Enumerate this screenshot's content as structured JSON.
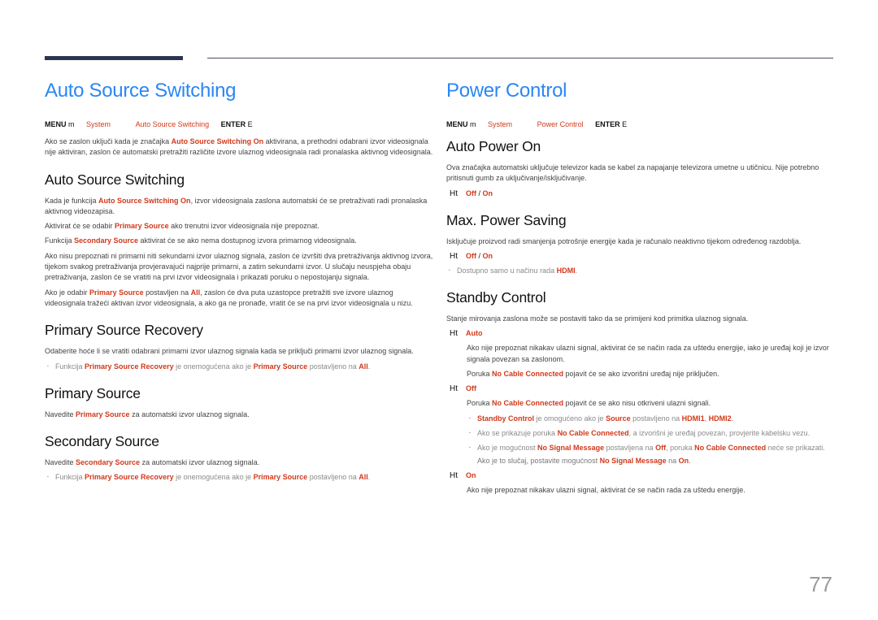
{
  "colors": {
    "title_blue": "#2a87f5",
    "accent_red": "#d1391b",
    "header_bar": "#2d3450"
  },
  "left": {
    "title": "Auto Source Switching",
    "menu": {
      "menu": "MENU",
      "menu_icon": "m",
      "system": "System",
      "item": "Auto Source Switching",
      "enter": "ENTER",
      "enter_icon": "E"
    },
    "intro": {
      "t1": "Ako se zaslon uključi kada je značajka ",
      "h1": "Auto Source Switching On",
      "t2": " aktivirana, a prethodni odabrani izvor videosignala nije aktiviran, zaslon će automatski pretražiti različite izvore ulaznog videosignala radi pronalaska aktivnog videosignala."
    },
    "s1": {
      "heading": "Auto Source Switching",
      "p1": {
        "t1": "Kada je funkcija ",
        "h1": "Auto Source Switching On",
        "t2": ", izvor videosignala zaslona automatski će se pretraživati radi pronalaska aktivnog videozapisa."
      },
      "p2": {
        "t1": "Aktivirat će se odabir ",
        "h1": "Primary Source",
        "t2": " ako trenutni izvor videosignala nije prepoznat."
      },
      "p3": {
        "t1": "Funkcija ",
        "h1": "Secondary Source",
        "t2": " aktivirat će se ako nema dostupnog izvora primarnog videosignala."
      },
      "p4": "Ako nisu prepoznati ni primarni niti sekundarni izvor ulaznog signala, zaslon će izvršiti dva pretraživanja aktivnog izvora, tijekom svakog pretraživanja provjeravajući najprije primarni, a zatim sekundarni izvor. U slučaju neuspjeha obaju pretraživanja, zaslon će se vratiti na prvi izvor videosignala i prikazati poruku o nepostojanju signala.",
      "p5": {
        "t1": "Ako je odabir ",
        "h1": "Primary Source",
        "t2": " postavljen na ",
        "h2": "All",
        "t3": ", zaslon će dva puta uzastopce pretražiti sve izvore ulaznog videosignala tražeći aktivan izvor videosignala, a ako ga ne pronađe, vratit će se na prvi izvor videosignala u nizu."
      }
    },
    "s2": {
      "heading": "Primary Source Recovery",
      "p1": "Odaberite hoće li se vratiti odabrani primarni izvor ulaznog signala kada se priključi primarni izvor ulaznog signala.",
      "note": {
        "t1": "Funkcija ",
        "h1": "Primary Source Recovery",
        "t2": " je onemogućena ako je ",
        "h2": "Primary Source",
        "t3": " postavljeno na ",
        "h3": "All",
        "t4": "."
      }
    },
    "s3": {
      "heading": "Primary Source",
      "p1": {
        "t1": "Navedite ",
        "h1": "Primary Source",
        "t2": " za automatski izvor ulaznog signala."
      }
    },
    "s4": {
      "heading": "Secondary Source",
      "p1": {
        "t1": "Navedite ",
        "h1": "Secondary Source",
        "t2": " za automatski izvor ulaznog signala."
      },
      "note": {
        "t1": "Funkcija ",
        "h1": "Primary Source Recovery",
        "t2": " je onemogućena ako je ",
        "h2": "Primary Source",
        "t3": " postavljeno na ",
        "h3": "All",
        "t4": "."
      }
    }
  },
  "right": {
    "title": "Power Control",
    "menu": {
      "menu": "MENU",
      "menu_icon": "m",
      "system": "System",
      "item": "Power Control",
      "enter": "ENTER",
      "enter_icon": "E"
    },
    "s1": {
      "heading": "Auto Power On",
      "p1": "Ova značajka automatski uključuje televizor kada se kabel za napajanje televizora umetne u utičnicu. Nije potrebno pritisnuti gumb za uključivanje/isključivanje.",
      "opt": {
        "ht": "Ht",
        "o1": "Off",
        "sep": " / ",
        "o2": "On"
      }
    },
    "s2": {
      "heading": "Max. Power Saving",
      "p1": "Isključuje proizvod radi smanjenja potrošnje energije kada je računalo neaktivno tijekom određenog razdoblja.",
      "opt": {
        "ht": "Ht",
        "o1": "Off",
        "sep": " / ",
        "o2": "On"
      },
      "note": {
        "t1": "Dostupno samo u načinu rada ",
        "h1": "HDMI",
        "t2": "."
      }
    },
    "s3": {
      "heading": "Standby Control",
      "p1": "Stanje mirovanja zaslona može se postaviti tako da se primijeni kod primitka ulaznog signala.",
      "auto": {
        "ht": "Ht",
        "label": "Auto",
        "d1": "Ako nije prepoznat nikakav ulazni signal, aktivirat će se način rada za uštedu energije, iako je uređaj koji je izvor signala povezan sa zaslonom.",
        "d2": {
          "t1": "Poruka ",
          "h1": "No Cable Connected",
          "t2": " pojavit će se ako izvorišni uređaj nije priključen."
        }
      },
      "off": {
        "ht": "Ht",
        "label": "Off",
        "d1": {
          "t1": "Poruka ",
          "h1": "No Cable Connected",
          "t2": " pojavit će se ako nisu otkriveni ulazni signali."
        }
      },
      "notes": {
        "n1": {
          "h1": "Standby Control",
          "t1": " je omogućeno ako je ",
          "h2": "Source",
          "t2": " postavljeno na ",
          "h3": "HDMI1",
          "t3": ", ",
          "h4": "HDMI2",
          "t4": "."
        },
        "n2": {
          "t1": "Ako se prikazuje poruka ",
          "h1": "No Cable Connected",
          "t2": ", a izvorišni je uređaj povezan, provjerite kabelsku vezu."
        },
        "n3": {
          "t1": "Ako je mogućnost ",
          "h1": "No Signal Message",
          "t2": " postavljena na ",
          "h2": "Off",
          "t3": ", poruka ",
          "h3": "No Cable Connected",
          "t4": " neće se prikazati."
        },
        "n3b": {
          "t1": "Ako je to slučaj, postavite mogućnost ",
          "h1": "No Signal Message",
          "t2": " na ",
          "h2": "On",
          "t3": "."
        }
      },
      "on": {
        "ht": "Ht",
        "label": "On",
        "d1": "Ako nije prepoznat nikakav ulazni signal, aktivirat će se način rada za uštedu energije."
      }
    }
  },
  "page_number": "77"
}
